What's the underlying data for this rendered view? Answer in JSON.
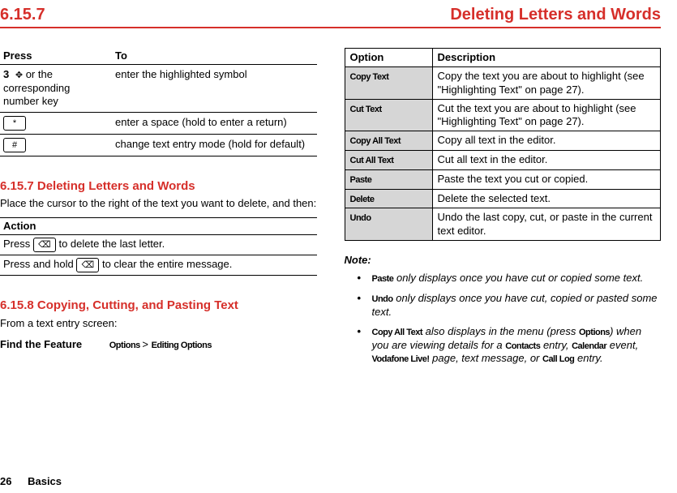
{
  "header": {
    "left": "6.15.7",
    "right": "Deleting Letters and Words"
  },
  "leftcol": {
    "press_header": {
      "press": "Press",
      "to": "To"
    },
    "press_rows": [
      {
        "num": "3",
        "keytxt": "or the corresponding number key",
        "to": "enter the highlighted symbol"
      },
      {
        "num": "",
        "keytxt": "",
        "to": "enter a space (hold to enter a return)",
        "iconTxt": "*"
      },
      {
        "num": "",
        "keytxt": "",
        "to": "change text entry mode (hold for default)",
        "iconTxt": "#"
      }
    ],
    "s1_title": "6.15.7 Deleting Letters and Words",
    "s1_para": "Place the cursor to the right of the text you want to delete, and then:",
    "action_header": "Action",
    "action_rows": [
      {
        "pre": "Press ",
        "key": "⌫",
        "post": " to delete the last letter."
      },
      {
        "pre": "Press and hold ",
        "key": "⌫",
        "post": " to clear the entire message."
      }
    ],
    "s2_title": "6.15.8 Copying, Cutting, and Pasting Text",
    "s2_para": "From a text entry screen:",
    "find_feature_label": "Find the Feature",
    "find_feature_path_a": "Options ",
    "find_feature_sep": " > ",
    "find_feature_path_b": "Editing Options"
  },
  "rightcol": {
    "opt_header": {
      "option": "Option",
      "desc": "Description"
    },
    "options": [
      {
        "name": "Copy Text",
        "desc": "Copy the text you are about to highlight (see \"Highlighting Text\" on page 27)."
      },
      {
        "name": "Cut Text",
        "desc": "Cut the text you are about to highlight (see \"Highlighting Text\" on page 27)."
      },
      {
        "name": "Copy All Text",
        "desc": "Copy all text in the editor."
      },
      {
        "name": "Cut All Text",
        "desc": "Cut all text in the editor."
      },
      {
        "name": "Paste",
        "desc": "Paste the text you cut or copied."
      },
      {
        "name": "Delete",
        "desc": "Delete the selected text."
      },
      {
        "name": "Undo",
        "desc": "Undo the last copy, cut, or paste in the current text editor."
      }
    ],
    "note_label": "Note:",
    "notes": [
      {
        "bold": "Paste",
        "rest": " only displays once you have cut or copied some text."
      },
      {
        "bold": "Undo",
        "rest": " only displays once you have cut, copied or pasted some text."
      },
      {
        "bold": "Copy All Text",
        "rest1": " also displays in the menu (press ",
        "b2": "Options",
        "rest2": ") when you are viewing details for a ",
        "b3": "Contacts",
        "rest3": " entry, ",
        "b4": "Calendar",
        "rest4": " event, ",
        "b5": "Vodafone Live!",
        "rest5": " page, text message, or ",
        "b6": "Call Log",
        "rest6": " entry."
      }
    ]
  },
  "footer": {
    "page": "26",
    "section": "Basics"
  }
}
